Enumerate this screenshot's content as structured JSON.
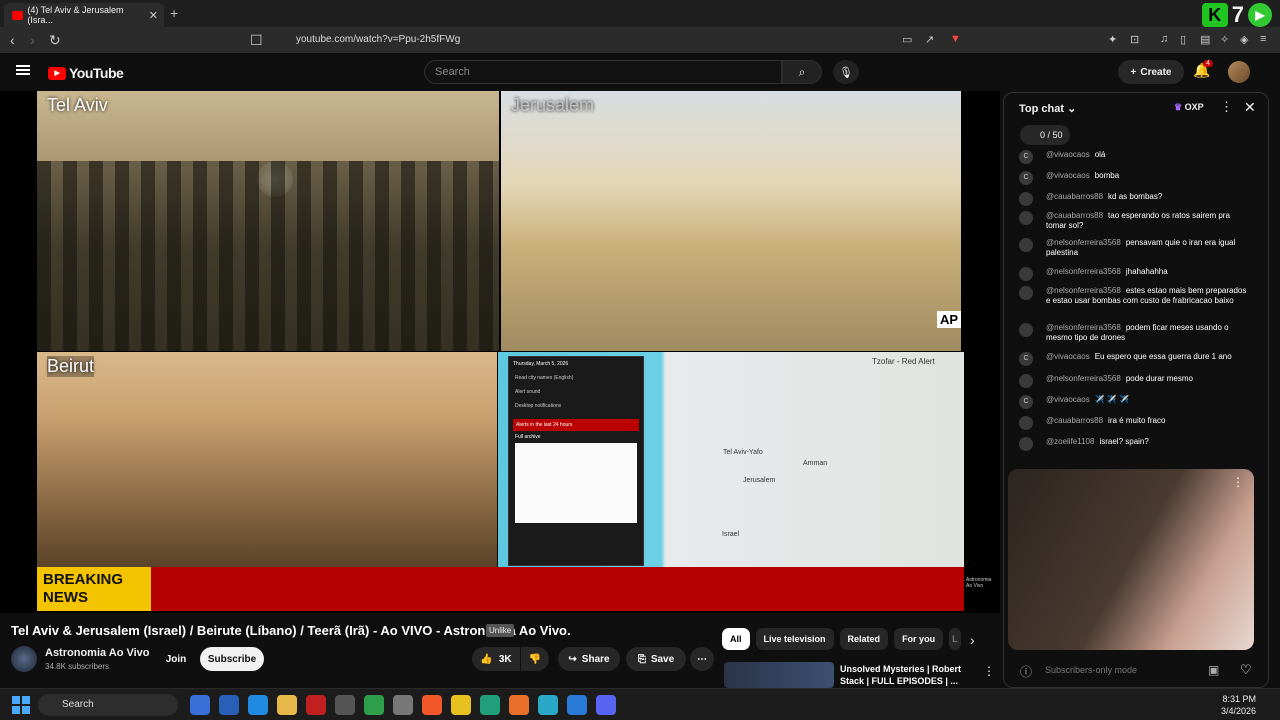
{
  "browser": {
    "tab_title": "(4) Tel Aviv & Jerusalem (Isra...",
    "tab_close": "✕",
    "new_tab": "+",
    "url": "youtube.com/watch?v=Ppu-2h5fFWg",
    "ext_count": "7"
  },
  "header": {
    "logo_text": "YouTube",
    "search_placeholder": "Search",
    "create_label": "Create",
    "notification_count": "4"
  },
  "video": {
    "labels": [
      "Tel Aviv",
      "Jerusalem",
      "Beirut"
    ],
    "ap_label": "AP",
    "breaking": "BREAKING NEWS",
    "tzofar_label": "Tzofar - Red Alert",
    "map_country": "Israel",
    "map_cities": [
      "Tel Aviv-Yafo",
      "Amman",
      "Jerusalem"
    ],
    "alert_panel": {
      "date": "Thursday, March 5, 2026",
      "items": [
        "Read city names (English)",
        "Alert sound",
        "Desktop notifications",
        "Alerts in the last 24 hours",
        "Full archive"
      ]
    },
    "watermark": "Astronomia Ao Vivo"
  },
  "below": {
    "title": "Tel Aviv & Jerusalem (Israel) / Beirute (Líbano) / Teerã (Irã) - Ao VIVO - Astronomia Ao Vivo.",
    "tooltip": "Unlike",
    "channel_name": "Astronomia Ao Vivo",
    "subscribers": "34.8K subscribers",
    "join": "Join",
    "subscribe": "Subscribe",
    "likes": "3K",
    "share": "Share",
    "save": "Save"
  },
  "chips": [
    "All",
    "Live television",
    "Related",
    "For you",
    "L"
  ],
  "recommendation": {
    "title": "Unsolved Mysteries | Robert Stack | FULL EPISODES | ..."
  },
  "chat": {
    "header": "Top chat",
    "badge": "OXP",
    "goal": "0 / 50",
    "input_placeholder": "Subscribers-only mode",
    "messages": [
      {
        "author": "@vivaocaos",
        "text": "olá",
        "initial": "C"
      },
      {
        "author": "@vivaocaos",
        "text": "bomba",
        "initial": "C"
      },
      {
        "author": "@cauabarros88",
        "text": "kd as bombas?",
        "initial": ""
      },
      {
        "author": "@cauabarros88",
        "text": "tao esperando os ratos sairem pra tomar sol?",
        "initial": ""
      },
      {
        "author": "@nelsonferreira3568",
        "text": "pensavam quie o iran era igual palestina",
        "initial": ""
      },
      {
        "author": "@nelsonferreira3568",
        "text": "jhahahahha",
        "initial": ""
      },
      {
        "author": "@nelsonferreira3568",
        "text": "estes estao mais bem preparados e estao usar bombas com custo de frabricacao baixo",
        "initial": ""
      },
      {
        "author": "@nelsonferreira3568",
        "text": "podem ficar meses usando o mesmo tipo de drones",
        "initial": ""
      },
      {
        "author": "@vivaocaos",
        "text": "Eu espero que essa guerra dure 1 ano",
        "initial": "C"
      },
      {
        "author": "@nelsonferreira3568",
        "text": "pode durar mesmo",
        "initial": ""
      },
      {
        "author": "@vivaocaos",
        "text": "✈️ ✈️ ✈️",
        "initial": "C"
      },
      {
        "author": "@cauabarros88",
        "text": "ira é muito fraco",
        "initial": ""
      },
      {
        "author": "@zoelife1108",
        "text": "israel? spain?",
        "initial": ""
      }
    ]
  },
  "taskbar": {
    "search": "Search",
    "time": "8:31 PM",
    "date": "3/4/2026"
  }
}
